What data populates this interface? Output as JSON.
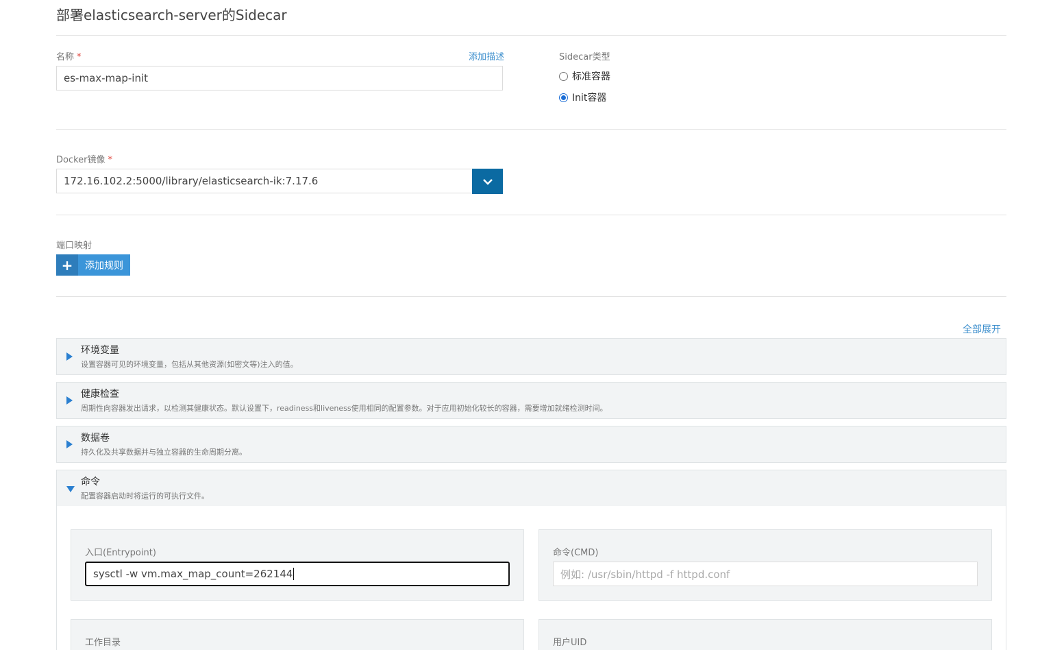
{
  "header": {
    "title": "部署elasticsearch-server的Sidecar"
  },
  "name_field": {
    "label": "名称",
    "required_mark": "*",
    "add_description": "添加描述",
    "value": "es-max-map-init"
  },
  "sidecar_type": {
    "label": "Sidecar类型",
    "options": [
      {
        "label": "标准容器",
        "checked": false
      },
      {
        "label": "Init容器",
        "checked": true
      }
    ]
  },
  "docker_image": {
    "label": "Docker镜像",
    "required_mark": "*",
    "value": "172.16.102.2:5000/library/elasticsearch-ik:7.17.6",
    "dropdown_icon": "chevron-down-icon"
  },
  "port_mapping": {
    "label": "端口映射",
    "add_rule_label": "添加规则",
    "add_icon": "plus-icon"
  },
  "expand_all": "全部展开",
  "sections": [
    {
      "title": "环境变量",
      "desc": "设置容器可见的环境变量，包括从其他资源(如密文等)注入的值。",
      "expanded": false
    },
    {
      "title": "健康检查",
      "desc": "周期性向容器发出请求，以检测其健康状态。默认设置下，readiness和liveness使用相同的配置参数。对于应用初始化较长的容器，需要增加就绪检测时间。",
      "expanded": false
    },
    {
      "title": "数据卷",
      "desc": "持久化及共享数据并与独立容器的生命周期分离。",
      "expanded": false
    },
    {
      "title": "命令",
      "desc": "配置容器启动时将运行的可执行文件。",
      "expanded": true
    }
  ],
  "command": {
    "entrypoint_label": "入口(Entrypoint)",
    "entrypoint_value": "sysctl -w vm.max_map_count=262144",
    "cmd_label": "命令(CMD)",
    "cmd_placeholder": "例如: /usr/sbin/httpd -f httpd.conf",
    "workdir_label": "工作目录",
    "uid_label": "用户UID"
  },
  "colors": {
    "accent": "#3b95d9",
    "dark_accent": "#0b6aa2",
    "link": "#3d8fcd",
    "required": "#e0433a"
  }
}
